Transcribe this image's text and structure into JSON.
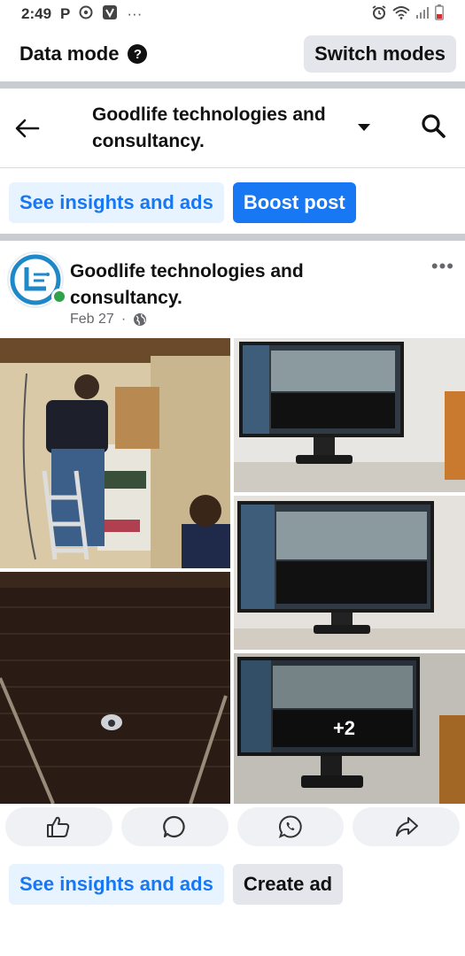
{
  "status_bar": {
    "time": "2:49",
    "indicator_letter": "P",
    "more": "···"
  },
  "mode_bar": {
    "title": "Data mode",
    "help": "?",
    "switch_label": "Switch modes"
  },
  "page_header": {
    "page_name": "Goodlife technologies and consultancy."
  },
  "top_actions": {
    "insights_label": "See insights and ads",
    "boost_label": "Boost post"
  },
  "post": {
    "author": "Goodlife technologies and consultancy.",
    "date": "Feb 27",
    "separator": "·",
    "more_photos": "+2"
  },
  "reactions": {
    "icons": [
      "like-icon",
      "comment-icon",
      "whatsapp-icon",
      "share-icon"
    ]
  },
  "bottom_actions": {
    "insights_label": "See insights and ads",
    "create_ad_label": "Create ad"
  },
  "colors": {
    "brand_blue": "#1877f2",
    "light_blue": "#e7f3ff",
    "online_green": "#31a24c"
  }
}
